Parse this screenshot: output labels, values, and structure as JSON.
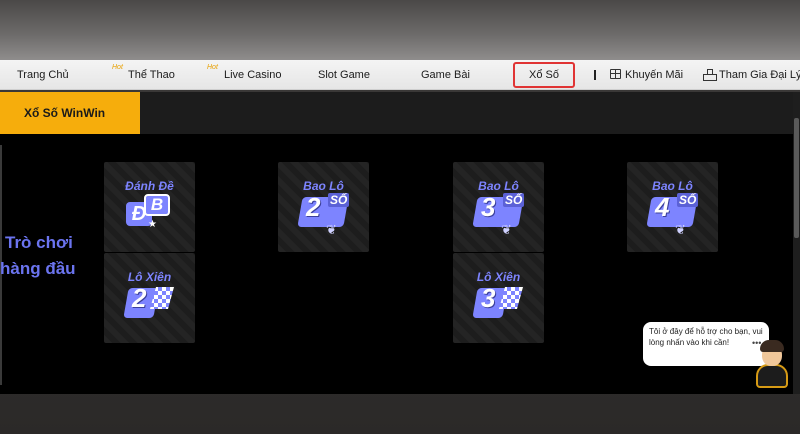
{
  "nav": {
    "items": [
      {
        "label": "Trang Chủ",
        "hot": ""
      },
      {
        "label": "Thể Thao",
        "hot": "Hot"
      },
      {
        "label": "Live Casino",
        "hot": "Hot"
      },
      {
        "label": "Slot Game",
        "hot": ""
      },
      {
        "label": "Game Bài",
        "hot": ""
      },
      {
        "label": "Xổ Số",
        "hot": ""
      },
      {
        "label": "Khuyến Mãi",
        "hot": ""
      },
      {
        "label": "Tham Gia Đại Lý",
        "hot": ""
      }
    ],
    "active": "Xổ Số"
  },
  "tabs": {
    "active_label": "Xổ Số WinWin"
  },
  "headline": {
    "line1": "Trò chơi",
    "line2": "hàng đầu"
  },
  "games": [
    {
      "title": "Đánh Đề",
      "badge": "ĐB"
    },
    {
      "title": "Bao Lô",
      "badge": "2",
      "unit": "SỐ"
    },
    {
      "title": "Bao Lô",
      "badge": "3",
      "unit": "SỐ"
    },
    {
      "title": "Bao Lô",
      "badge": "4",
      "unit": "SỐ"
    },
    {
      "title": "Lô Xiên",
      "badge": "2"
    },
    {
      "title": "Lô Xiên",
      "badge": "3"
    }
  ],
  "chat": {
    "message": "Tôi ở đây để hỗ trợ cho bạn, vui lòng nhấn vào khi cần!"
  },
  "colors": {
    "accent": "#f6ad0c",
    "brand_purple": "#7d84ff",
    "active_border": "#e03434"
  }
}
